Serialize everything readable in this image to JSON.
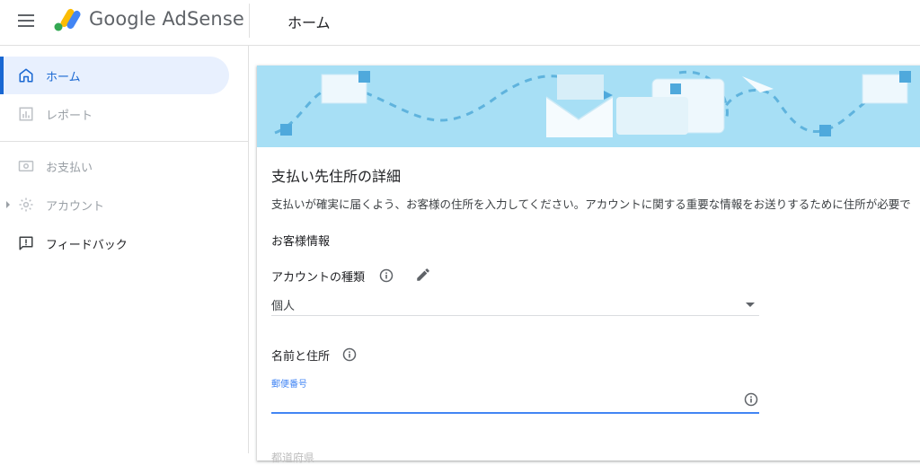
{
  "topbar": {
    "brand": "Google AdSense",
    "page_title": "ホーム"
  },
  "sidebar": {
    "items": [
      {
        "label": "ホーム",
        "icon": "home-icon",
        "state": "active"
      },
      {
        "label": "レポート",
        "icon": "bar-chart-icon",
        "state": "disabled"
      },
      {
        "label": "お支払い",
        "icon": "payments-icon",
        "state": "disabled"
      },
      {
        "label": "アカウント",
        "icon": "gear-icon",
        "state": "disabled"
      },
      {
        "label": "フィードバック",
        "icon": "feedback-icon",
        "state": "enabled"
      }
    ]
  },
  "card": {
    "title": "支払い先住所の詳細",
    "description": "支払いが確実に届くよう、お客様の住所を入力してください。アカウントに関する重要な情報をお送りするために住所が必要で",
    "section_label": "お客様情報",
    "account_type": {
      "label": "アカウントの種類",
      "value": "個人"
    },
    "name_address": {
      "label": "名前と住所",
      "postal_label": "郵便番号",
      "postal_value": ""
    },
    "cutoff_label": "都道府県"
  },
  "colors": {
    "accent": "#1967d2",
    "active_bg": "#e8f0fe",
    "banner_bg": "#a7dff5",
    "focus_blue": "#4285f4"
  }
}
